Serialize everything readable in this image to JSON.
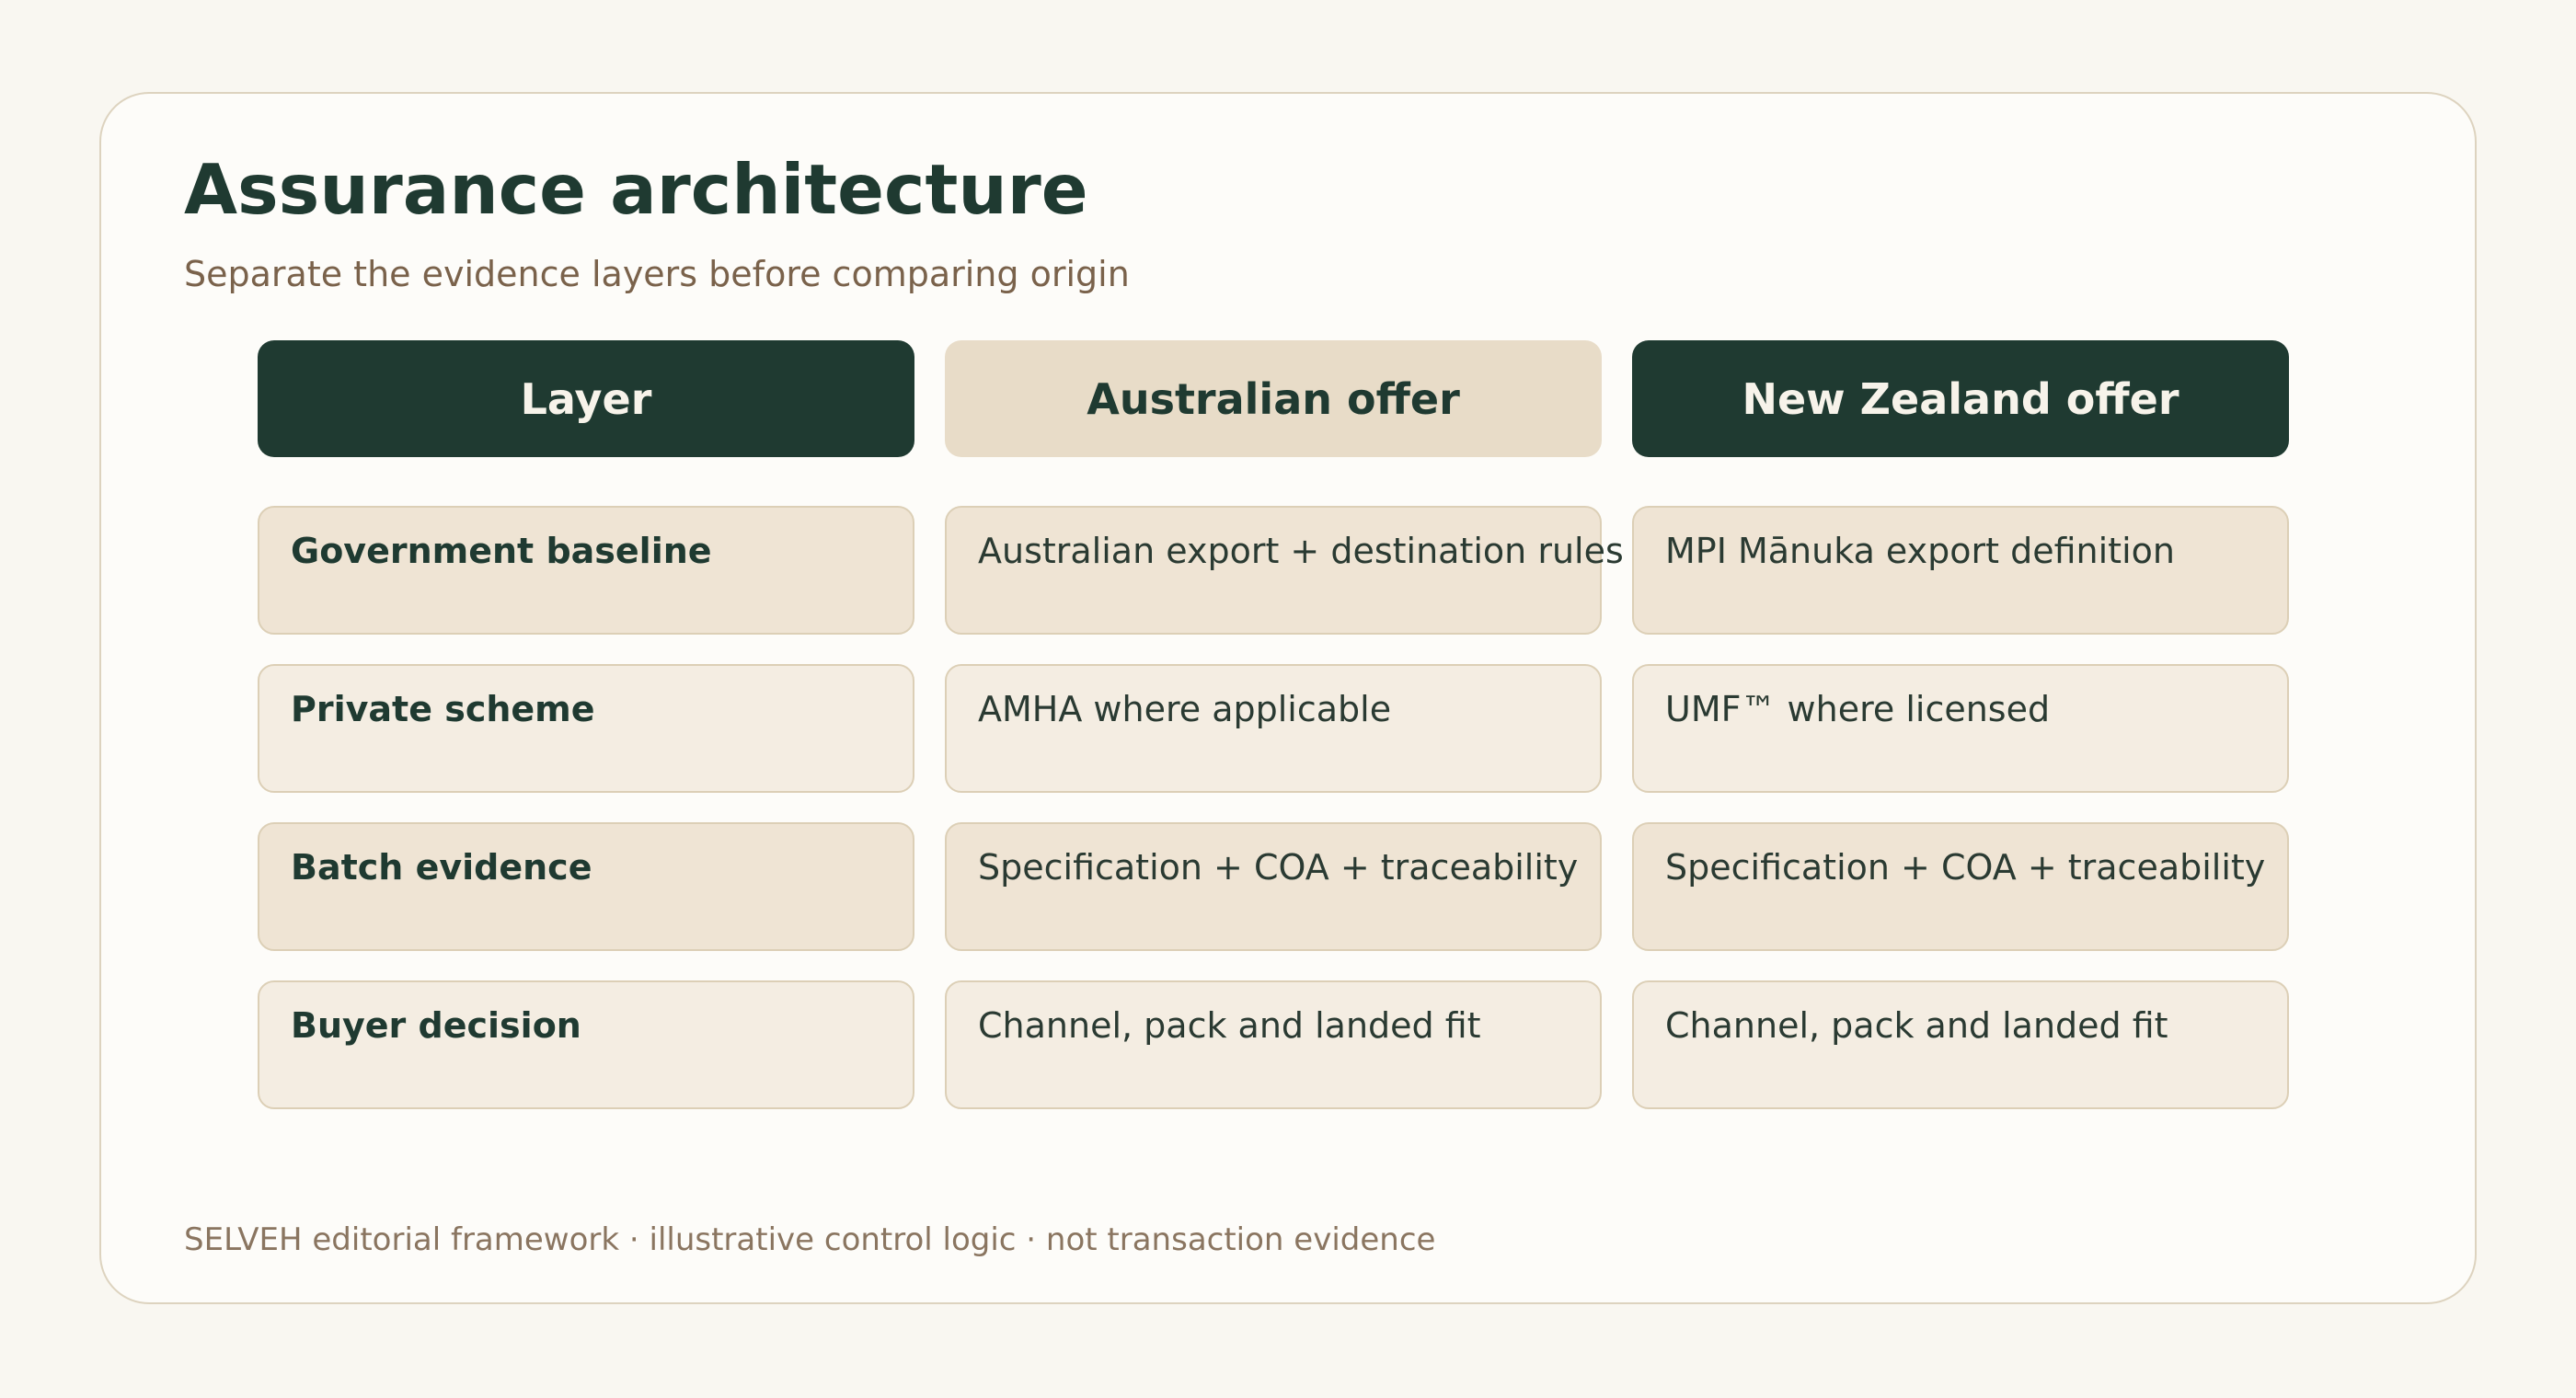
{
  "title": "Assurance architecture",
  "subtitle": "Separate the evidence layers before comparing origin",
  "columns": [
    "Layer",
    "Australian offer",
    "New Zealand offer"
  ],
  "rows": [
    [
      "Government baseline",
      "Australian export + destination rules",
      "MPI Mānuka export definition"
    ],
    [
      "Private scheme",
      "AMHA where applicable",
      "UMF™ where licensed"
    ],
    [
      "Batch evidence",
      "Specification + COA + traceability",
      "Specification + COA + traceability"
    ],
    [
      "Buyer decision",
      "Channel, pack and landed fit",
      "Channel, pack and landed fit"
    ]
  ],
  "footer": "SELVEH editorial framework · illustrative control logic · not transaction evidence",
  "colors": {
    "dark_green": "#1f3a31",
    "beige_header": "#e8dcc8",
    "row_odd": "#efe4d4",
    "row_even": "#f4ede2",
    "page_bg": "#f9f7f1"
  }
}
